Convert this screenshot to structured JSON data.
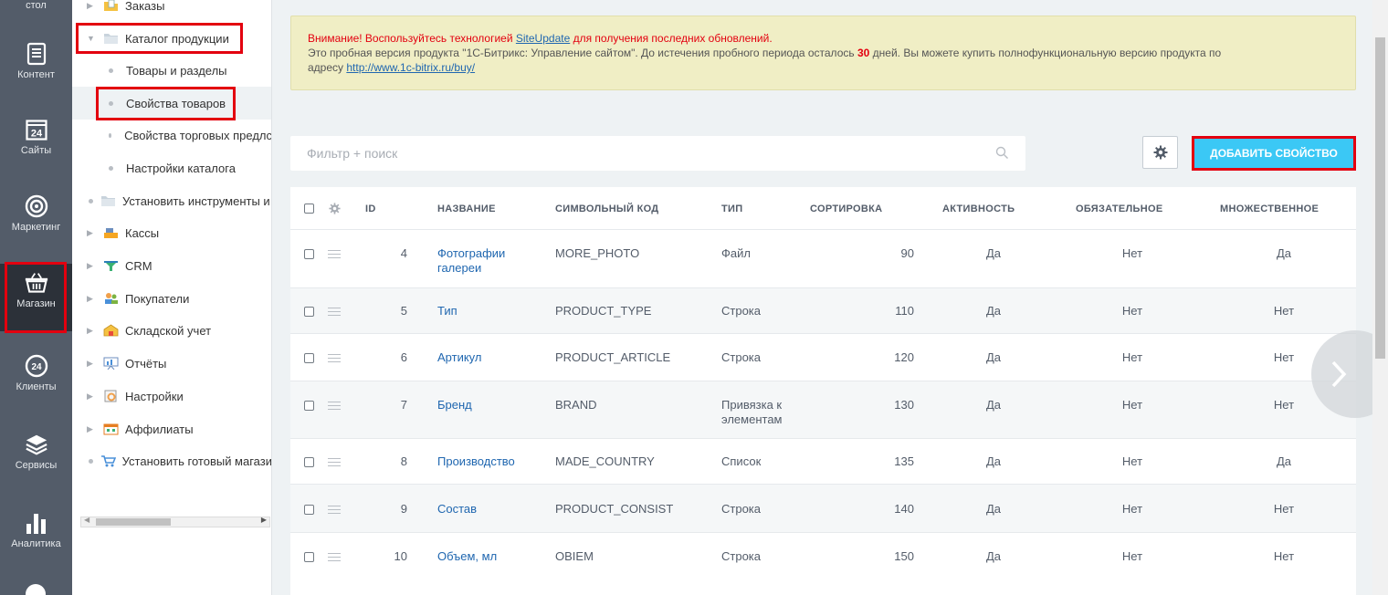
{
  "rail": {
    "items": [
      {
        "label": "стол",
        "icon": "desktop-icon"
      },
      {
        "label": "Контент",
        "icon": "document-icon"
      },
      {
        "label": "Сайты",
        "icon": "calendar-24-icon"
      },
      {
        "label": "Маркетинг",
        "icon": "target-icon"
      },
      {
        "label": "Магазин",
        "icon": "basket-icon",
        "active": true
      },
      {
        "label": "Клиенты",
        "icon": "clients-24-icon"
      },
      {
        "label": "Сервисы",
        "icon": "layers-icon"
      },
      {
        "label": "Аналитика",
        "icon": "bar-chart-icon"
      }
    ]
  },
  "tree": {
    "items": [
      {
        "label": "Заказы",
        "icon": "orders-folder-icon",
        "arrow": "▶"
      },
      {
        "label": "Каталог продукции",
        "icon": "folder-icon",
        "arrow": "▼"
      },
      {
        "label": "Товары и разделы"
      },
      {
        "label": "Свойства товаров"
      },
      {
        "label": "Свойства торговых предлс"
      },
      {
        "label": "Настройки каталога"
      },
      {
        "label": "Установить инструменты и",
        "icon": "folder-icon"
      },
      {
        "label": "Кассы",
        "icon": "cashbox-icon",
        "arrow": "▶"
      },
      {
        "label": "CRM",
        "icon": "crm-icon",
        "arrow": "▶"
      },
      {
        "label": "Покупатели",
        "icon": "buyers-icon",
        "arrow": "▶"
      },
      {
        "label": "Складской учет",
        "icon": "warehouse-icon",
        "arrow": "▶"
      },
      {
        "label": "Отчёты",
        "icon": "reports-icon",
        "arrow": "▶"
      },
      {
        "label": "Настройки",
        "icon": "settings-icon",
        "arrow": "▶"
      },
      {
        "label": "Аффилиаты",
        "icon": "affiliates-icon",
        "arrow": "▶"
      },
      {
        "label": "Установить готовый магази",
        "icon": "cart-icon"
      }
    ]
  },
  "notice": {
    "warning": "Внимание! Воспользуйтесь технологией ",
    "link1": "SiteUpdate",
    "warning_tail": " для получения последних обновлений.",
    "line2_start": "Это пробная версия продукта \"1С-Битрикс: Управление сайтом\". До истечения пробного периода осталось ",
    "days": "30",
    "line2_end": " дней. Вы можете купить полнофункциональную версию продукта по",
    "line3_start": "адресу ",
    "link2": "http://www.1c-bitrix.ru/buy/"
  },
  "search": {
    "placeholder": "Фильтр + поиск"
  },
  "toolbar": {
    "add_label": "ДОБАВИТЬ СВОЙСТВО"
  },
  "table": {
    "headers": {
      "id": "ID",
      "name": "НАЗВАНИЕ",
      "code": "СИМВОЛЬНЫЙ КОД",
      "type": "ТИП",
      "sort": "СОРТИРОВКА",
      "active": "АКТИВНОСТЬ",
      "required": "ОБЯЗАТЕЛЬНОЕ",
      "multiple": "МНОЖЕСТВЕННОЕ"
    },
    "rows": [
      {
        "id": "4",
        "name": "Фотографии галереи",
        "name_l1": "Фотографии",
        "name_l2": "галереи",
        "code": "MORE_PHOTO",
        "type": "Файл",
        "type_l2": "",
        "sort": "90",
        "active": "Да",
        "required": "Нет",
        "multiple": "Да"
      },
      {
        "id": "5",
        "name": "Тип",
        "name_l1": "Тип",
        "name_l2": "",
        "code": "PRODUCT_TYPE",
        "type": "Строка",
        "type_l2": "",
        "sort": "110",
        "active": "Да",
        "required": "Нет",
        "multiple": "Нет"
      },
      {
        "id": "6",
        "name": "Артикул",
        "name_l1": "Артикул",
        "name_l2": "",
        "code": "PRODUCT_ARTICLE",
        "type": "Строка",
        "type_l2": "",
        "sort": "120",
        "active": "Да",
        "required": "Нет",
        "multiple": "Нет"
      },
      {
        "id": "7",
        "name": "Бренд",
        "name_l1": "Бренд",
        "name_l2": "",
        "code": "BRAND",
        "type": "Привязка к",
        "type_l2": "элементам",
        "sort": "130",
        "active": "Да",
        "required": "Нет",
        "multiple": "Нет"
      },
      {
        "id": "8",
        "name": "Производство",
        "name_l1": "Производство",
        "name_l2": "",
        "code": "MADE_COUNTRY",
        "type": "Список",
        "type_l2": "",
        "sort": "135",
        "active": "Да",
        "required": "Нет",
        "multiple": "Да"
      },
      {
        "id": "9",
        "name": "Состав",
        "name_l1": "Состав",
        "name_l2": "",
        "code": "PRODUCT_CONSIST",
        "type": "Строка",
        "type_l2": "",
        "sort": "140",
        "active": "Да",
        "required": "Нет",
        "multiple": "Нет"
      },
      {
        "id": "10",
        "name": "Объем, мл",
        "name_l1": "Объем, мл",
        "name_l2": "",
        "code": "OBIEM",
        "type": "Строка",
        "type_l2": "",
        "sort": "150",
        "active": "Да",
        "required": "Нет",
        "multiple": "Нет"
      }
    ]
  },
  "colors": {
    "accent": "#3bc8f5",
    "highlight": "#e3000f",
    "link": "#2067b0",
    "rail": "#535c69"
  }
}
